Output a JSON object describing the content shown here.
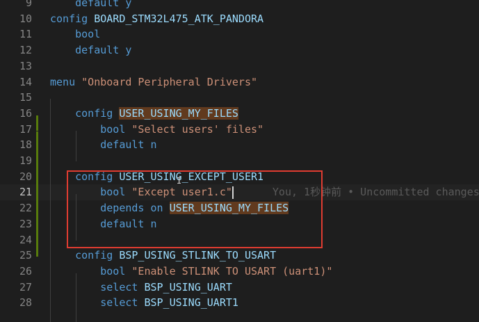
{
  "editor": {
    "lines": [
      {
        "num": "9",
        "code": [
          {
            "t": "    ",
            "c": "plain"
          },
          {
            "t": "default y",
            "c": "kw"
          }
        ]
      },
      {
        "num": "10",
        "code": [
          {
            "t": "config ",
            "c": "kw"
          },
          {
            "t": "BOARD_STM32L475_ATK_PANDORA",
            "c": "sym"
          }
        ]
      },
      {
        "num": "11",
        "code": [
          {
            "t": "    ",
            "c": "plain"
          },
          {
            "t": "bool",
            "c": "kw"
          }
        ]
      },
      {
        "num": "12",
        "code": [
          {
            "t": "    ",
            "c": "plain"
          },
          {
            "t": "default ",
            "c": "kw"
          },
          {
            "t": "y",
            "c": "kw"
          }
        ]
      },
      {
        "num": "13",
        "code": []
      },
      {
        "num": "14",
        "code": [
          {
            "t": "menu ",
            "c": "kw"
          },
          {
            "t": "\"Onboard Peripheral Drivers\"",
            "c": "str"
          }
        ]
      },
      {
        "num": "15",
        "code": []
      },
      {
        "num": "16",
        "code": [
          {
            "t": "    ",
            "c": "plain"
          },
          {
            "t": "config ",
            "c": "kw"
          },
          {
            "t": "USER_USING_MY_FILES",
            "c": "sym hl"
          }
        ]
      },
      {
        "num": "17",
        "code": [
          {
            "t": "        ",
            "c": "plain"
          },
          {
            "t": "bool ",
            "c": "kw"
          },
          {
            "t": "\"Select users' files\"",
            "c": "str"
          }
        ]
      },
      {
        "num": "18",
        "code": [
          {
            "t": "        ",
            "c": "plain"
          },
          {
            "t": "default ",
            "c": "kw"
          },
          {
            "t": "n",
            "c": "kw"
          }
        ]
      },
      {
        "num": "19",
        "code": []
      },
      {
        "num": "20",
        "code": [
          {
            "t": "    ",
            "c": "plain"
          },
          {
            "t": "config ",
            "c": "kw"
          },
          {
            "t": "USER_USING_EXCEPT_USER1",
            "c": "sym"
          }
        ]
      },
      {
        "num": "21",
        "code": [
          {
            "t": "        ",
            "c": "plain"
          },
          {
            "t": "bool ",
            "c": "kw"
          },
          {
            "t": "\"Except user1.c\"",
            "c": "str"
          }
        ],
        "blame": "You, 1秒钟前 • Uncommitted changes",
        "current": true
      },
      {
        "num": "22",
        "code": [
          {
            "t": "        ",
            "c": "plain"
          },
          {
            "t": "depends ",
            "c": "kw"
          },
          {
            "t": "on ",
            "c": "kw"
          },
          {
            "t": "USER_USING_MY_FILES",
            "c": "sym hl"
          }
        ]
      },
      {
        "num": "23",
        "code": [
          {
            "t": "        ",
            "c": "plain"
          },
          {
            "t": "default ",
            "c": "kw"
          },
          {
            "t": "n",
            "c": "kw"
          }
        ]
      },
      {
        "num": "24",
        "code": []
      },
      {
        "num": "25",
        "code": [
          {
            "t": "    ",
            "c": "plain"
          },
          {
            "t": "config ",
            "c": "kw"
          },
          {
            "t": "BSP_USING_STLINK_TO_USART",
            "c": "sym"
          }
        ]
      },
      {
        "num": "26",
        "code": [
          {
            "t": "        ",
            "c": "plain"
          },
          {
            "t": "bool ",
            "c": "kw"
          },
          {
            "t": "\"Enable STLINK TO USART (uart1)\"",
            "c": "str"
          }
        ]
      },
      {
        "num": "27",
        "code": [
          {
            "t": "        ",
            "c": "plain"
          },
          {
            "t": "select ",
            "c": "kw"
          },
          {
            "t": "BSP_USING_UART",
            "c": "sym"
          }
        ]
      },
      {
        "num": "28",
        "code": [
          {
            "t": "        ",
            "c": "plain"
          },
          {
            "t": "select ",
            "c": "kw"
          },
          {
            "t": "BSP_USING_UART1",
            "c": "sym"
          }
        ]
      }
    ]
  },
  "colors": {
    "background": "#1e1e1e",
    "keyword": "#569cd6",
    "string": "#ce9178",
    "symbol": "#9cdcfe",
    "highlight": "#613a1e",
    "git_added": "#587c0c",
    "annotation_box": "#e03c31"
  }
}
